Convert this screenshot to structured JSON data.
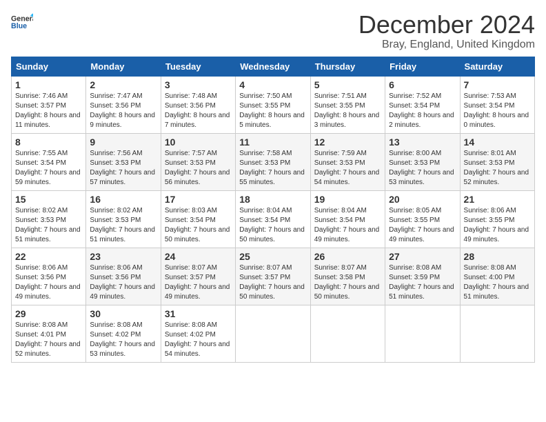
{
  "header": {
    "logo_general": "General",
    "logo_blue": "Blue",
    "month_title": "December 2024",
    "subtitle": "Bray, England, United Kingdom"
  },
  "days_of_week": [
    "Sunday",
    "Monday",
    "Tuesday",
    "Wednesday",
    "Thursday",
    "Friday",
    "Saturday"
  ],
  "weeks": [
    [
      {
        "day": "1",
        "sunrise": "Sunrise: 7:46 AM",
        "sunset": "Sunset: 3:57 PM",
        "daylight": "Daylight: 8 hours and 11 minutes."
      },
      {
        "day": "2",
        "sunrise": "Sunrise: 7:47 AM",
        "sunset": "Sunset: 3:56 PM",
        "daylight": "Daylight: 8 hours and 9 minutes."
      },
      {
        "day": "3",
        "sunrise": "Sunrise: 7:48 AM",
        "sunset": "Sunset: 3:56 PM",
        "daylight": "Daylight: 8 hours and 7 minutes."
      },
      {
        "day": "4",
        "sunrise": "Sunrise: 7:50 AM",
        "sunset": "Sunset: 3:55 PM",
        "daylight": "Daylight: 8 hours and 5 minutes."
      },
      {
        "day": "5",
        "sunrise": "Sunrise: 7:51 AM",
        "sunset": "Sunset: 3:55 PM",
        "daylight": "Daylight: 8 hours and 3 minutes."
      },
      {
        "day": "6",
        "sunrise": "Sunrise: 7:52 AM",
        "sunset": "Sunset: 3:54 PM",
        "daylight": "Daylight: 8 hours and 2 minutes."
      },
      {
        "day": "7",
        "sunrise": "Sunrise: 7:53 AM",
        "sunset": "Sunset: 3:54 PM",
        "daylight": "Daylight: 8 hours and 0 minutes."
      }
    ],
    [
      {
        "day": "8",
        "sunrise": "Sunrise: 7:55 AM",
        "sunset": "Sunset: 3:54 PM",
        "daylight": "Daylight: 7 hours and 59 minutes."
      },
      {
        "day": "9",
        "sunrise": "Sunrise: 7:56 AM",
        "sunset": "Sunset: 3:53 PM",
        "daylight": "Daylight: 7 hours and 57 minutes."
      },
      {
        "day": "10",
        "sunrise": "Sunrise: 7:57 AM",
        "sunset": "Sunset: 3:53 PM",
        "daylight": "Daylight: 7 hours and 56 minutes."
      },
      {
        "day": "11",
        "sunrise": "Sunrise: 7:58 AM",
        "sunset": "Sunset: 3:53 PM",
        "daylight": "Daylight: 7 hours and 55 minutes."
      },
      {
        "day": "12",
        "sunrise": "Sunrise: 7:59 AM",
        "sunset": "Sunset: 3:53 PM",
        "daylight": "Daylight: 7 hours and 54 minutes."
      },
      {
        "day": "13",
        "sunrise": "Sunrise: 8:00 AM",
        "sunset": "Sunset: 3:53 PM",
        "daylight": "Daylight: 7 hours and 53 minutes."
      },
      {
        "day": "14",
        "sunrise": "Sunrise: 8:01 AM",
        "sunset": "Sunset: 3:53 PM",
        "daylight": "Daylight: 7 hours and 52 minutes."
      }
    ],
    [
      {
        "day": "15",
        "sunrise": "Sunrise: 8:02 AM",
        "sunset": "Sunset: 3:53 PM",
        "daylight": "Daylight: 7 hours and 51 minutes."
      },
      {
        "day": "16",
        "sunrise": "Sunrise: 8:02 AM",
        "sunset": "Sunset: 3:53 PM",
        "daylight": "Daylight: 7 hours and 51 minutes."
      },
      {
        "day": "17",
        "sunrise": "Sunrise: 8:03 AM",
        "sunset": "Sunset: 3:54 PM",
        "daylight": "Daylight: 7 hours and 50 minutes."
      },
      {
        "day": "18",
        "sunrise": "Sunrise: 8:04 AM",
        "sunset": "Sunset: 3:54 PM",
        "daylight": "Daylight: 7 hours and 50 minutes."
      },
      {
        "day": "19",
        "sunrise": "Sunrise: 8:04 AM",
        "sunset": "Sunset: 3:54 PM",
        "daylight": "Daylight: 7 hours and 49 minutes."
      },
      {
        "day": "20",
        "sunrise": "Sunrise: 8:05 AM",
        "sunset": "Sunset: 3:55 PM",
        "daylight": "Daylight: 7 hours and 49 minutes."
      },
      {
        "day": "21",
        "sunrise": "Sunrise: 8:06 AM",
        "sunset": "Sunset: 3:55 PM",
        "daylight": "Daylight: 7 hours and 49 minutes."
      }
    ],
    [
      {
        "day": "22",
        "sunrise": "Sunrise: 8:06 AM",
        "sunset": "Sunset: 3:56 PM",
        "daylight": "Daylight: 7 hours and 49 minutes."
      },
      {
        "day": "23",
        "sunrise": "Sunrise: 8:06 AM",
        "sunset": "Sunset: 3:56 PM",
        "daylight": "Daylight: 7 hours and 49 minutes."
      },
      {
        "day": "24",
        "sunrise": "Sunrise: 8:07 AM",
        "sunset": "Sunset: 3:57 PM",
        "daylight": "Daylight: 7 hours and 49 minutes."
      },
      {
        "day": "25",
        "sunrise": "Sunrise: 8:07 AM",
        "sunset": "Sunset: 3:57 PM",
        "daylight": "Daylight: 7 hours and 50 minutes."
      },
      {
        "day": "26",
        "sunrise": "Sunrise: 8:07 AM",
        "sunset": "Sunset: 3:58 PM",
        "daylight": "Daylight: 7 hours and 50 minutes."
      },
      {
        "day": "27",
        "sunrise": "Sunrise: 8:08 AM",
        "sunset": "Sunset: 3:59 PM",
        "daylight": "Daylight: 7 hours and 51 minutes."
      },
      {
        "day": "28",
        "sunrise": "Sunrise: 8:08 AM",
        "sunset": "Sunset: 4:00 PM",
        "daylight": "Daylight: 7 hours and 51 minutes."
      }
    ],
    [
      {
        "day": "29",
        "sunrise": "Sunrise: 8:08 AM",
        "sunset": "Sunset: 4:01 PM",
        "daylight": "Daylight: 7 hours and 52 minutes."
      },
      {
        "day": "30",
        "sunrise": "Sunrise: 8:08 AM",
        "sunset": "Sunset: 4:02 PM",
        "daylight": "Daylight: 7 hours and 53 minutes."
      },
      {
        "day": "31",
        "sunrise": "Sunrise: 8:08 AM",
        "sunset": "Sunset: 4:02 PM",
        "daylight": "Daylight: 7 hours and 54 minutes."
      },
      null,
      null,
      null,
      null
    ]
  ]
}
